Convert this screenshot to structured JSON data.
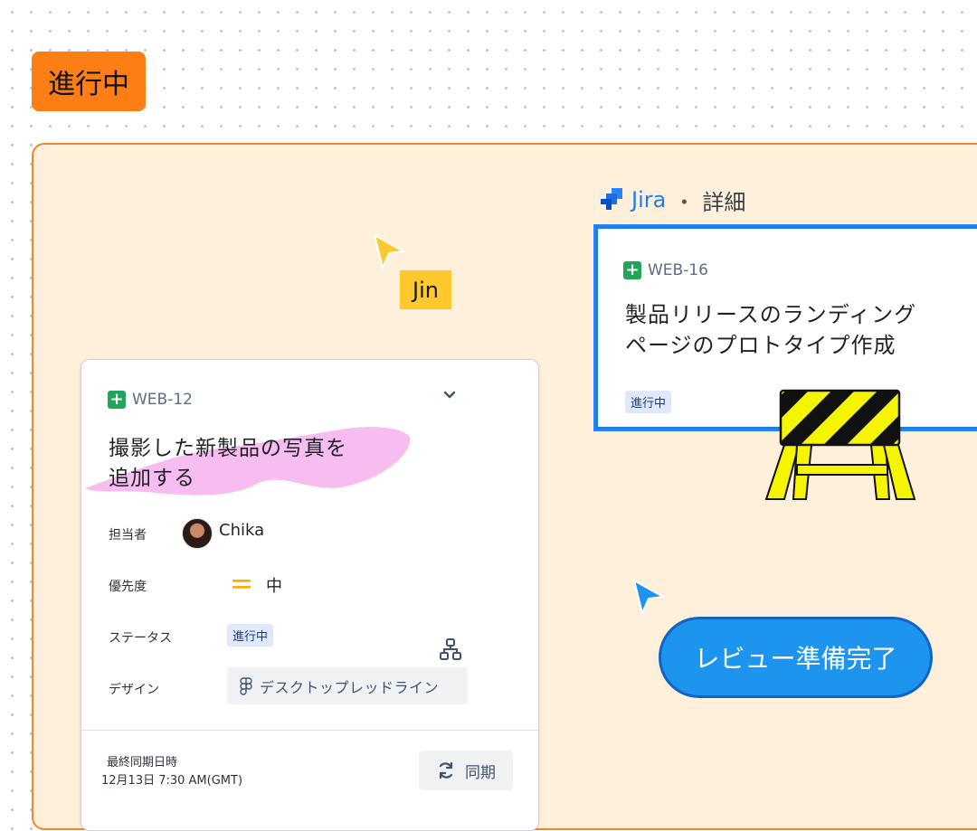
{
  "section": {
    "title": "進行中"
  },
  "cursors": {
    "jin_label": "Jin"
  },
  "jira": {
    "name": "Jira",
    "separator": "・",
    "detail": "詳細"
  },
  "card_web16": {
    "key": "WEB-16",
    "title_line1": "製品リリースのランディング",
    "title_line2": "ページのプロトタイプ作成",
    "status": "進行中"
  },
  "card_web12": {
    "key": "WEB-12",
    "title_line1": "撮影した新製品の写真を",
    "title_line2": "追加する",
    "fields": {
      "assignee_label": "担当者",
      "assignee_name": "Chika",
      "priority_label": "優先度",
      "priority_value": "中",
      "status_label": "ステータス",
      "status_value": "進行中",
      "design_label": "デザイン",
      "design_value": "デスクトップレッドライン"
    },
    "sync": {
      "last_sync_label": "最終同期日時",
      "last_sync_time": "12月13日 7:30 AM(GMT)",
      "sync_button": "同期"
    }
  },
  "review_button": {
    "label": "レビュー準備完了"
  },
  "colors": {
    "section_orange": "#fd7e14",
    "frame_bg": "#fff0dc",
    "jira_blue": "#1c7ee6",
    "review_blue": "#1d95ef",
    "highlight_pink": "#f7b8ef",
    "priority_orange": "#ffab00",
    "cursor_yellow": "#ffc82c"
  }
}
